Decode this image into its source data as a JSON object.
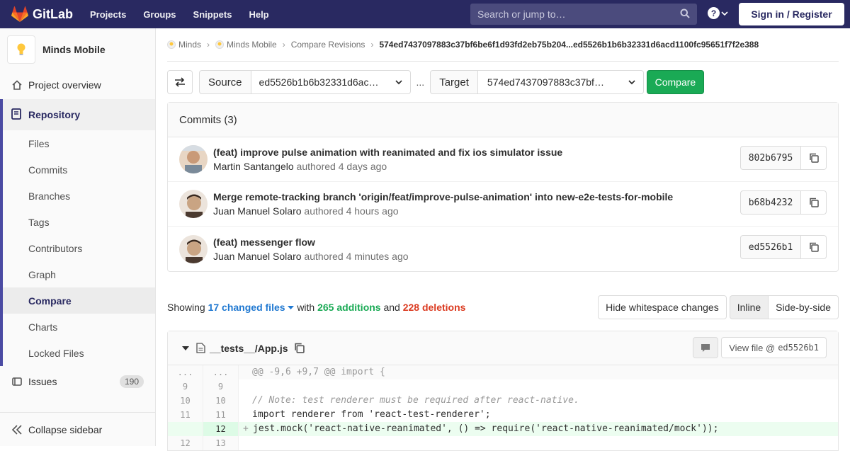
{
  "navbar": {
    "brand": "GitLab",
    "links": [
      "Projects",
      "Groups",
      "Snippets",
      "Help"
    ],
    "search_placeholder": "Search or jump to…",
    "signin": "Sign in / Register"
  },
  "sidebar": {
    "project_name": "Minds Mobile",
    "overview": "Project overview",
    "repository": "Repository",
    "repo_items": [
      "Files",
      "Commits",
      "Branches",
      "Tags",
      "Contributors",
      "Graph",
      "Compare",
      "Charts",
      "Locked Files"
    ],
    "active_item": "Compare",
    "issues": "Issues",
    "issues_count": "190",
    "collapse": "Collapse sidebar"
  },
  "breadcrumb": {
    "items": [
      "Minds",
      "Minds Mobile",
      "Compare Revisions"
    ],
    "current": "574ed7437097883c37bf6be6f1d93fd2eb75b204...ed5526b1b6b32331d6acd1100fc95651f7f2e388"
  },
  "compare": {
    "source_label": "Source",
    "source_value": "ed5526b1b6b32331d6ac…",
    "dots": "...",
    "target_label": "Target",
    "target_value": "574ed7437097883c37bf…",
    "button": "Compare"
  },
  "commits": {
    "header": "Commits (3)",
    "items": [
      {
        "title": "(feat) improve pulse animation with reanimated and fix ios simulator issue",
        "author": "Martin Santangelo",
        "verb": "authored",
        "time": "4 days ago",
        "sha": "802b6795"
      },
      {
        "title": "Merge remote-tracking branch 'origin/feat/improve-pulse-animation' into new-e2e-tests-for-mobile",
        "author": "Juan Manuel Solaro",
        "verb": "authored",
        "time": "4 hours ago",
        "sha": "b68b4232"
      },
      {
        "title": "(feat) messenger flow",
        "author": "Juan Manuel Solaro",
        "verb": "authored",
        "time": "4 minutes ago",
        "sha": "ed5526b1"
      }
    ]
  },
  "stats": {
    "showing": "Showing",
    "changed_files": "17 changed files",
    "with": "with",
    "additions": "265 additions",
    "and": "and",
    "deletions": "228 deletions",
    "hide_whitespace": "Hide whitespace changes",
    "inline": "Inline",
    "side_by_side": "Side-by-side"
  },
  "file": {
    "name": "__tests__/App.js",
    "view_file": "View file @",
    "view_sha": "ed5526b1",
    "lines": [
      {
        "old": "...",
        "new": "...",
        "type": "match",
        "text": "@@ -9,6 +9,7 @@ import {"
      },
      {
        "old": "9",
        "new": "9",
        "type": "ctx",
        "text": ""
      },
      {
        "old": "10",
        "new": "10",
        "type": "ctx",
        "text": "// Note: test renderer must be required after react-native."
      },
      {
        "old": "11",
        "new": "11",
        "type": "ctx",
        "text": "import renderer from 'react-test-renderer';"
      },
      {
        "old": "",
        "new": "12",
        "type": "added",
        "text": "jest.mock('react-native-reanimated', () => require('react-native-reanimated/mock'));"
      },
      {
        "old": "12",
        "new": "13",
        "type": "ctx",
        "text": ""
      }
    ]
  },
  "colors": {
    "navbar": "#292961",
    "compare_button": "#1aaa55",
    "additions": "#1aaa55",
    "deletions": "#db3b21",
    "link": "#1f78d1"
  }
}
